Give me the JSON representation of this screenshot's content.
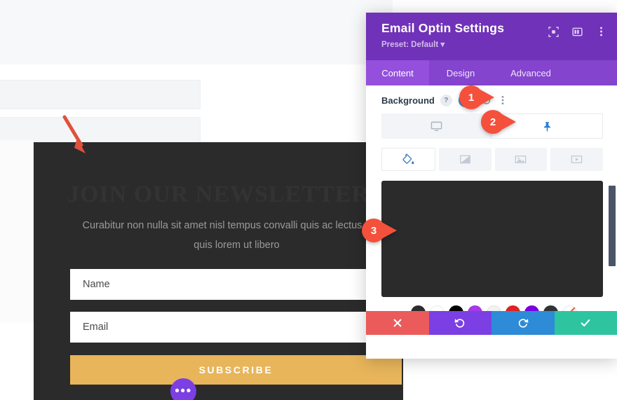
{
  "background_page": {
    "rows_placeholder": [
      "",
      "",
      "",
      "",
      ""
    ]
  },
  "optin_module": {
    "heading": "JOIN OUR NEWSLETTER",
    "subtext": "Curabitur non nulla sit amet nisl tempus convalli quis ac lectus. Nulla quis lorem ut libero",
    "name_field_placeholder": "Name",
    "email_field_placeholder": "Email",
    "submit_label": "SUBSCRIBE",
    "more_options_label": "•••",
    "background_color": "#2b2b2b",
    "submit_color": "#e8b55b"
  },
  "annotations": {
    "arrow_color": "#e8503c",
    "badges": [
      {
        "number": "1",
        "target": "pin-background-setting"
      },
      {
        "number": "2",
        "target": "hover-state-tab"
      },
      {
        "number": "3",
        "target": "background-color-preview"
      }
    ]
  },
  "modal": {
    "title": "Email Optin Settings",
    "preset_label": "Preset: Default",
    "preset_caret": "▾",
    "header_icons": [
      {
        "name": "focus-icon",
        "glyph": "◉"
      },
      {
        "name": "layout-columns-icon",
        "glyph": "▥"
      },
      {
        "name": "more-vertical-icon",
        "glyph": "⋮"
      }
    ],
    "tabs": [
      {
        "label": "Content",
        "active": true
      },
      {
        "label": "Design",
        "active": false
      },
      {
        "label": "Advanced",
        "active": false
      }
    ],
    "section": {
      "label": "Background",
      "help_glyph": "?",
      "pin_glyph": "pin-icon",
      "reset_glyph": "↺",
      "menu_glyph": "⋮"
    },
    "device_tabs": [
      {
        "name": "desktop-icon",
        "active": false
      },
      {
        "name": "pin-icon",
        "active": true
      }
    ],
    "background_types": [
      {
        "name": "paint-bucket-icon",
        "active": true
      },
      {
        "name": "gradient-icon",
        "active": false
      },
      {
        "name": "image-icon",
        "active": false
      },
      {
        "name": "video-icon",
        "active": false
      }
    ],
    "preview_color": "#2b2b2b",
    "swatches": {
      "more_glyph": "•••",
      "colors": [
        "#2c2c2c",
        "#fdfdfd",
        "#000000",
        "#a939e8",
        "#f2f2f2",
        "#e62020",
        "#7b00e0",
        "#333333"
      ],
      "none_label": "no-color"
    },
    "actions": [
      {
        "name": "cancel-button",
        "glyph": "✖",
        "color": "#eb5b5b"
      },
      {
        "name": "undo-button",
        "glyph": "↺",
        "color": "#7b3fe4"
      },
      {
        "name": "redo-button",
        "glyph": "↻",
        "color": "#2d8bd8"
      },
      {
        "name": "save-button",
        "glyph": "✔",
        "color": "#2ec4a0"
      }
    ]
  }
}
